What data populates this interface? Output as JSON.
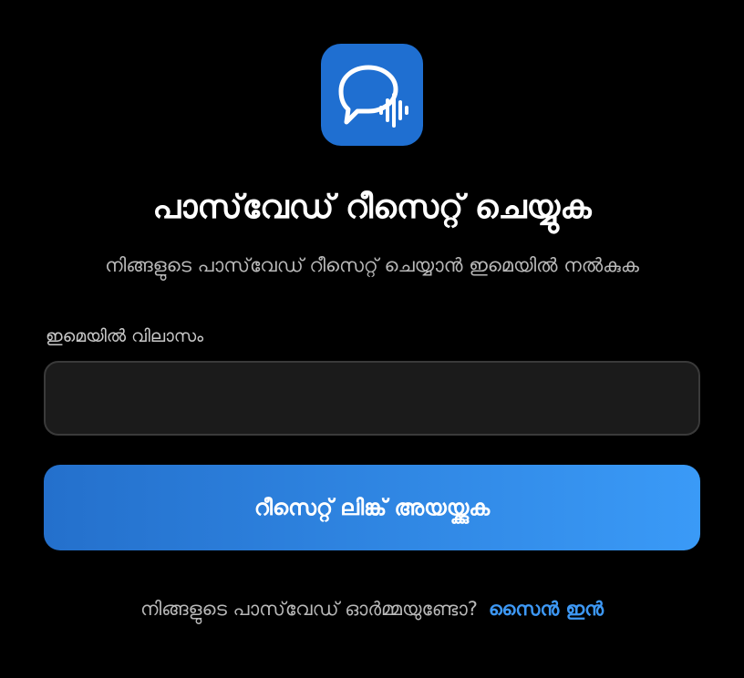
{
  "app": {
    "logo_icon": "chat-bubble-soundwave-icon",
    "logo_color": "#1f6fd1"
  },
  "header": {
    "title": "പാസ്‌വേഡ് റീസെറ്റ് ചെയ്യുക",
    "subtitle": "നിങ്ങളുടെ പാസ്‌വേഡ് റീസെറ്റ് ചെയ്യാൻ ഇമെയിൽ നൽകുക"
  },
  "form": {
    "email_label": "ഇമെയിൽ വിലാസം",
    "email_value": "",
    "email_placeholder": "",
    "submit_label": "റീസെറ്റ് ലിങ്ക് അയയ്ക്കുക",
    "submit_gradient": [
      "#2470cc",
      "#3a9af7"
    ]
  },
  "footer": {
    "prompt": "നിങ്ങളുടെ പാസ്‌വേഡ് ഓർമ്മയുണ്ടോ?",
    "signin_label": "സൈൻ ഇൻ",
    "link_color": "#3d98f5"
  }
}
